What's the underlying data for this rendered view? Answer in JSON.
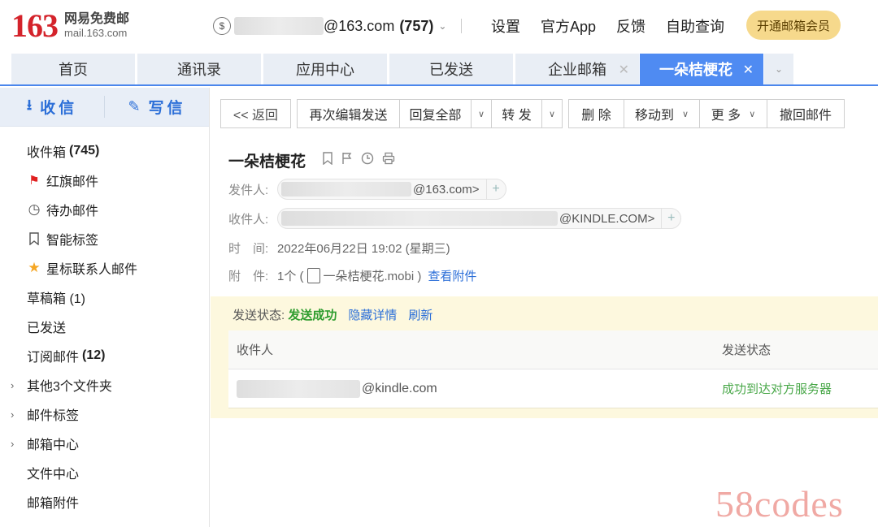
{
  "app": {
    "logo_number": "163",
    "logo_cn": "网易免费邮",
    "logo_domain": "mail.163.com",
    "account_suffix": "@163.com",
    "unread_count": "(757)",
    "account_icon": "$",
    "top_links": [
      "设置",
      "官方App",
      "反馈",
      "自助查询"
    ],
    "vip_button": "开通邮箱会员"
  },
  "tabs": [
    {
      "label": "首页",
      "closable": false,
      "active": false
    },
    {
      "label": "通讯录",
      "closable": false,
      "active": false
    },
    {
      "label": "应用中心",
      "closable": false,
      "active": false
    },
    {
      "label": "已发送",
      "closable": false,
      "active": false
    },
    {
      "label": "企业邮箱",
      "closable": true,
      "active": false
    },
    {
      "label": "一朵桔梗花",
      "closable": true,
      "active": true
    }
  ],
  "sidebar": {
    "receive_label": "收信",
    "write_label": "写信",
    "folders": [
      {
        "label": "收件箱",
        "count": "(745)",
        "icon": ""
      },
      {
        "label": "红旗邮件",
        "count": "",
        "icon": "flag-icon"
      },
      {
        "label": "待办邮件",
        "count": "",
        "icon": "clock-icon"
      },
      {
        "label": "智能标签",
        "count": "",
        "icon": "tag-icon"
      },
      {
        "label": "星标联系人邮件",
        "count": "",
        "icon": "star-icon"
      },
      {
        "label": "草稿箱 (1)",
        "count": "",
        "icon": ""
      },
      {
        "label": "已发送",
        "count": "",
        "icon": ""
      },
      {
        "label": "订阅邮件",
        "count": "(12)",
        "icon": ""
      },
      {
        "label": "其他3个文件夹",
        "count": "",
        "icon": "",
        "expandable": true
      },
      {
        "label": "邮件标签",
        "count": "",
        "icon": "",
        "expandable": true
      },
      {
        "label": "邮箱中心",
        "count": "",
        "icon": "",
        "expandable": true
      },
      {
        "label": "文件中心",
        "count": "",
        "icon": ""
      },
      {
        "label": "邮箱附件",
        "count": "",
        "icon": ""
      }
    ]
  },
  "toolbar": {
    "back": "<< 返回",
    "reedit": "再次编辑发送",
    "reply_all": "回复全部",
    "forward": "转 发",
    "delete": "删 除",
    "move_to": "移动到",
    "more": "更 多",
    "recall": "撤回邮件"
  },
  "mail": {
    "subject": "一朵桔梗花",
    "from_label": "发件人:",
    "from_suffix": "@163.com>",
    "to_label": "收件人:",
    "to_suffix": "@KINDLE.COM>",
    "time_label": "时　间:",
    "time_value": "2022年06月22日 19:02 (星期三)",
    "attach_label": "附　件:",
    "attach_count": "1个 (",
    "attach_name": "一朵桔梗花.mobi )",
    "attach_link": "查看附件"
  },
  "send_status": {
    "label": "发送状态:",
    "status": "发送成功",
    "hide_details": "隐藏详情",
    "refresh": "刷新",
    "col_recipient": "收件人",
    "col_status": "发送状态",
    "rows": [
      {
        "recipient_suffix": "@kindle.com",
        "status": "成功到达对方服务器"
      }
    ]
  },
  "watermark": "58codes"
}
